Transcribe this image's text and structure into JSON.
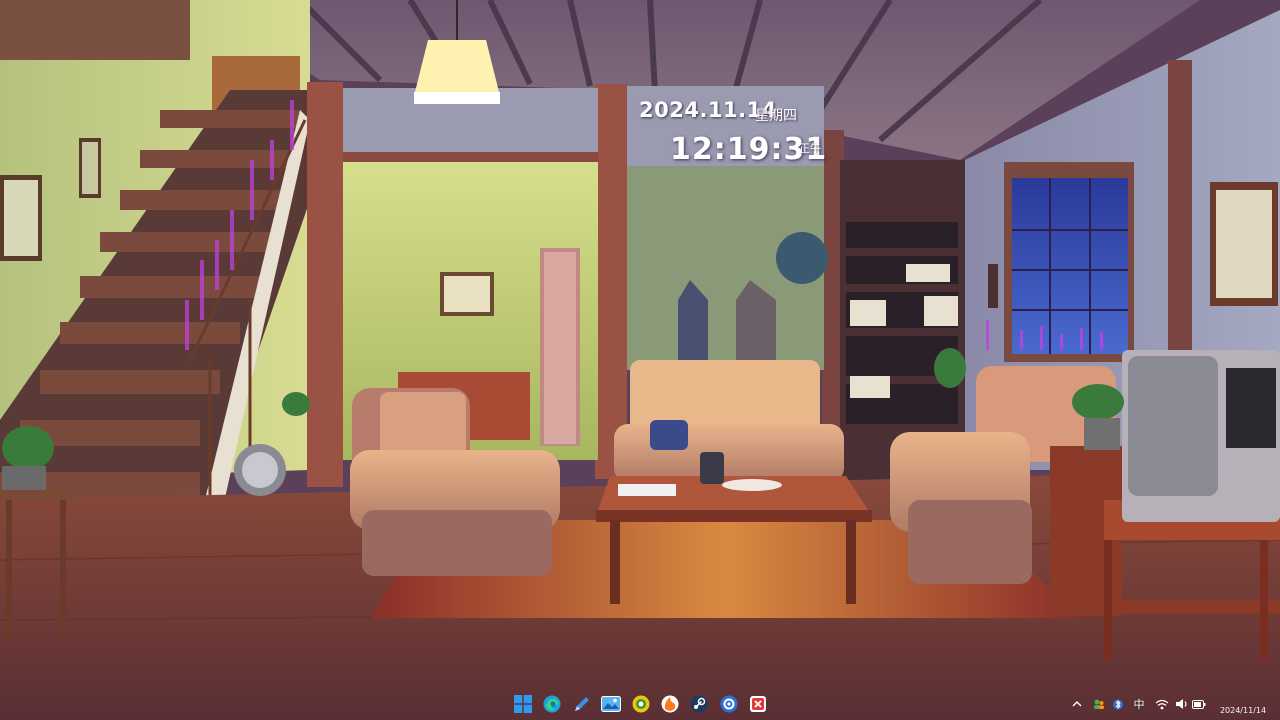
{
  "desktop": {
    "clock_widget": {
      "date": "2024.11.14",
      "weekday": "星期四",
      "time": "12:19:31",
      "period": "正午"
    }
  },
  "taskbar": {
    "pinned": [
      {
        "name": "start-button",
        "icon": "windows-logo-icon",
        "color": "#2f9bf0"
      },
      {
        "name": "edge-button",
        "icon": "edge-icon",
        "color": "#1ba3e0"
      },
      {
        "name": "pen-app-button",
        "icon": "pen-icon",
        "color": "#3a8ee6"
      },
      {
        "name": "photos-button",
        "icon": "photos-icon",
        "color": "#58b4f0"
      },
      {
        "name": "yellow-app-button",
        "icon": "circle-app-icon",
        "color": "#f4c20d"
      },
      {
        "name": "orange-app-button",
        "icon": "flame-icon",
        "color": "#ff7a1a"
      },
      {
        "name": "steam-button",
        "icon": "steam-icon",
        "color": "#1b3a5c"
      },
      {
        "name": "blue-app-button",
        "icon": "settings-app-icon",
        "color": "#2b6fd9"
      },
      {
        "name": "red-app-button",
        "icon": "snipping-icon",
        "color": "#e03a3a"
      }
    ],
    "tray": {
      "overflow_icon": "chevron-up-icon",
      "input_method": "中",
      "clock_date": "2024/11/14"
    }
  }
}
